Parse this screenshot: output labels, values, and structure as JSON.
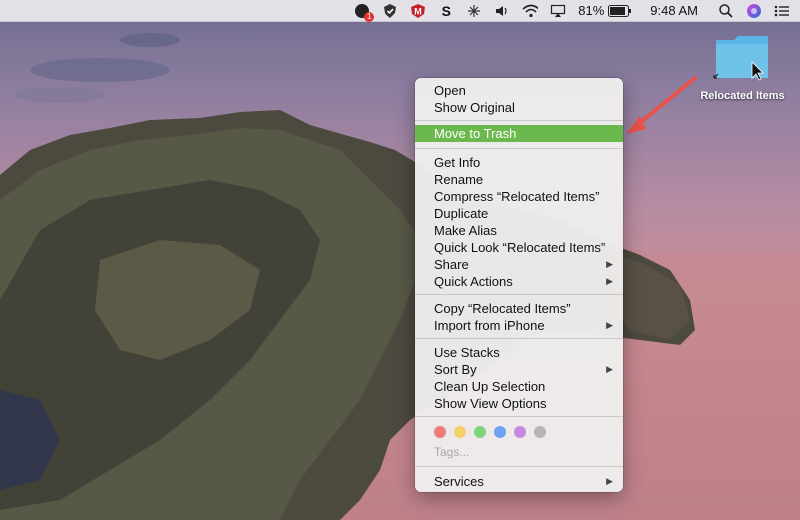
{
  "menubar": {
    "battery_percent": "81%",
    "time": "9:48 AM",
    "icons": [
      "notification-badge-icon",
      "security-shield-icon",
      "mcafee-icon",
      "s-app-icon",
      "spin-icon",
      "volume-icon",
      "wifi-icon",
      "airplay-icon",
      "battery-icon",
      "search-icon",
      "siri-icon",
      "list-icon"
    ],
    "badge_count": "1",
    "mcafee_letter": "M",
    "s_letter": "S"
  },
  "folder": {
    "label": "Relocated Items",
    "color": "#6fc3ea"
  },
  "context_menu": {
    "group1": [
      "Open",
      "Show Original"
    ],
    "highlighted": "Move to Trash",
    "group2": [
      "Get Info",
      "Rename",
      "Compress “Relocated Items”",
      "Duplicate",
      "Make Alias",
      "Quick Look “Relocated Items”",
      "Share",
      "Quick Actions"
    ],
    "group3": [
      "Copy “Relocated Items”",
      "Import from iPhone"
    ],
    "group4": [
      "Use Stacks",
      "Sort By",
      "Clean Up Selection",
      "Show View Options"
    ],
    "tags_placeholder": "Tags...",
    "services": "Services",
    "submenu_arrow": "▶",
    "tag_colors": [
      "#f07a78",
      "#f5cf6a",
      "#7fd47a",
      "#6fa3ef",
      "#c48be0",
      "#b5b5b5"
    ]
  },
  "colors": {
    "highlight": "#6bb84e",
    "annotation_arrow": "#e8524a"
  }
}
